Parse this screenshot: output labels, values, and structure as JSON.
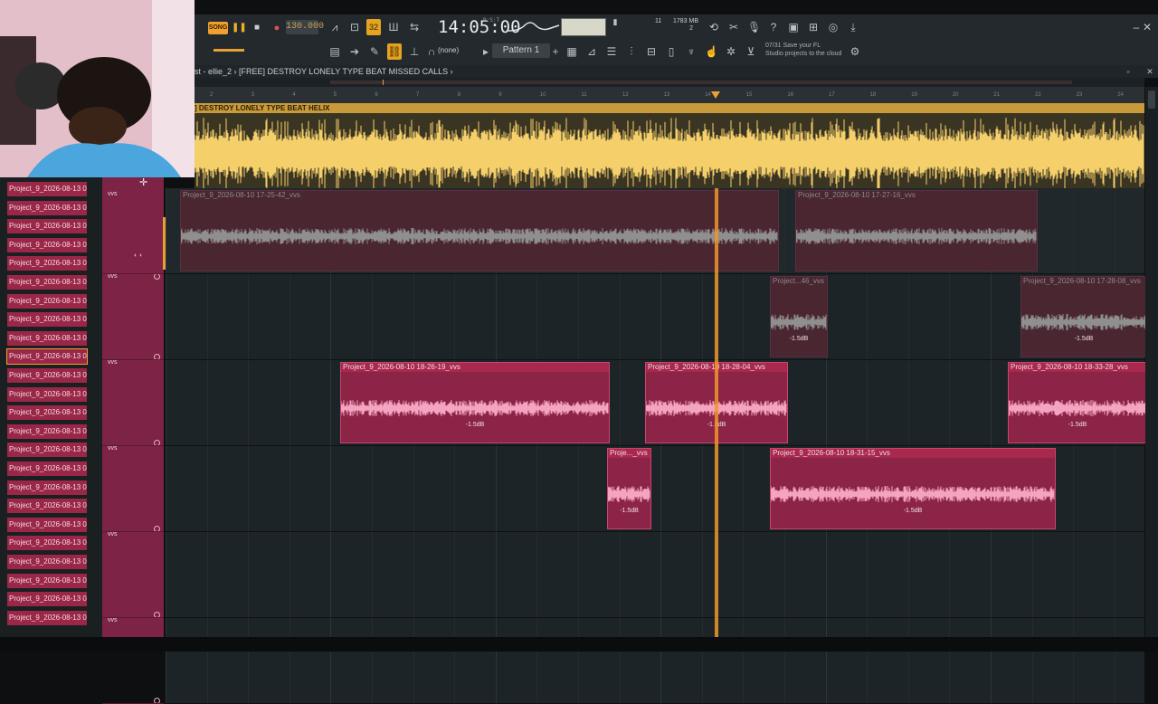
{
  "toolbar": {
    "song_mode": "SONG",
    "tempo": "130.000",
    "time": "14:05:00",
    "time_unit": "B:S:T",
    "memory": "1783 MB",
    "poly": "11",
    "poly2": "2",
    "snap": "(none)",
    "pattern": "Pattern 1",
    "cloud_line1": "07/31  Save your FL",
    "cloud_line2": "Studio projects to the cloud"
  },
  "breadcrumb": {
    "text": "st - ellie_2 › [FREE] DESTROY LONELY TYPE BEAT  MISSED CALLS ›"
  },
  "ruler": {
    "ticks": [
      "2",
      "3",
      "4",
      "5",
      "6",
      "7",
      "8",
      "9",
      "10",
      "11",
      "12",
      "13",
      "14",
      "15",
      "16",
      "17",
      "18",
      "19",
      "20",
      "21",
      "22",
      "23",
      "24"
    ]
  },
  "master_clip": {
    "title": "] DESTROY LONELY TYPE BEAT  HELIX"
  },
  "channels": [
    "Project_9_2026-08-13 0...",
    "Project_9_2026-08-13 0...",
    "Project_9_2026-08-13 0...",
    "Project_9_2026-08-13 0...",
    "Project_9_2026-08-13 0...",
    "Project_9_2026-08-13 0...",
    "Project_9_2026-08-13 0...",
    "Project_9_2026-08-13 0...",
    "Project_9_2026-08-13 0...",
    "Project_9_2026-08-13 0...",
    "Project_9_2026-08-13 0...",
    "Project_9_2026-08-13 0...",
    "Project_9_2026-08-13 0...",
    "Project_9_2026-08-13 0...",
    "Project_9_2026-08-13 0...",
    "Project_9_2026-08-13 0...",
    "Project_9_2026-08-13 0...",
    "Project_9_2026-08-13 0...",
    "Project_9_2026-08-13 0...",
    "Project_9_2026-08-13 0...",
    "Project_9_2026-08-13 0...",
    "Project_9_2026-08-13 0...",
    "Project_9_2026-08-13 0...",
    "Project_9_2026-08-13 0..."
  ],
  "tracks": [
    {
      "label": "vvs"
    },
    {
      "label": "vvs"
    },
    {
      "label": "vvs"
    },
    {
      "label": "vvs"
    },
    {
      "label": "vvs"
    },
    {
      "label": "vvs"
    }
  ],
  "clips": {
    "t1a": {
      "name": "Project_9_2026-08-10 17-25-42_vvs"
    },
    "t1b": {
      "name": "Project_9_2026-08-10 17-27-16_vvs"
    },
    "t2a": {
      "name": "Project...46_vvs",
      "vol": "-1.5dB"
    },
    "t2b": {
      "name": "Project_9_2026-08-10 17-28-08_vvs",
      "vol": "-1.5dB"
    },
    "t3a": {
      "name": "Project_9_2026-08-10 18-26-19_vvs",
      "vol": "-1.5dB"
    },
    "t3b": {
      "name": "Project_9_2026-08-10 18-28-04_vvs",
      "vol": "-1.5dB"
    },
    "t3c": {
      "name": "Project_9_2026-08-10 18-33-28_vvs",
      "vol": "-1.5dB"
    },
    "t4a": {
      "name": "Proje..._vvs",
      "vol": "-1.5dB"
    },
    "t4b": {
      "name": "Project_9_2026-08-10 18-31-15_vvs",
      "vol": "-1.5dB"
    }
  },
  "colors": {
    "clip_active": "#8c2448",
    "clip_muted": "#4a2630",
    "wave_active": "#f4a4c0",
    "wave_muted": "#8f8f90",
    "master_wave": "#f5d06a",
    "playhead": "#f0a030"
  }
}
